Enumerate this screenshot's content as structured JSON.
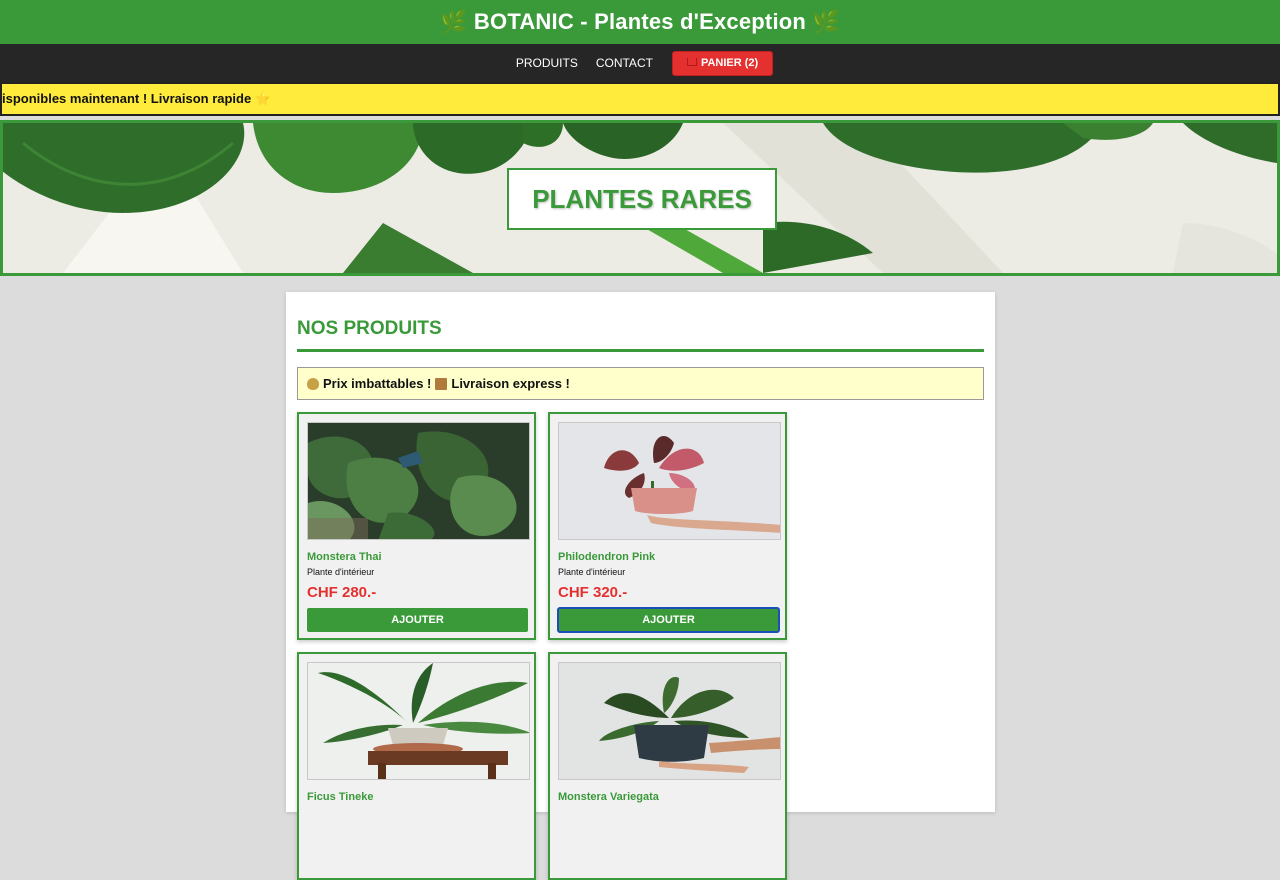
{
  "header": {
    "title": "🌿 BOTANIC - Plantes d'Exception 🌿"
  },
  "nav": {
    "items": [
      "PRODUITS",
      "CONTACT"
    ],
    "cart_label": "PANIER (2)"
  },
  "ticker": {
    "text": "isponibles maintenant ! Livraison rapide",
    "star": "⭐"
  },
  "hero": {
    "title": "PLANTES RARES"
  },
  "section": {
    "title": "NOS PRODUITS"
  },
  "promo": {
    "text_1": "Prix imbattables !",
    "text_2": "Livraison express !"
  },
  "products": [
    {
      "name": "Monstera Thai",
      "category": "Plante d'intérieur",
      "price": "CHF 280.-",
      "button": "AJOUTER"
    },
    {
      "name": "Philodendron Pink",
      "category": "Plante d'intérieur",
      "price": "CHF 320.-",
      "button": "AJOUTER"
    },
    {
      "name": "Ficus Tineke",
      "category": "",
      "price": "",
      "button": ""
    },
    {
      "name": "Monstera Variegata",
      "category": "",
      "price": "",
      "button": ""
    }
  ],
  "colors": {
    "brand_green": "#3a9a3a",
    "price_red": "#e53030",
    "ticker_yellow": "#ffeb3b",
    "nav_dark": "#262626"
  }
}
